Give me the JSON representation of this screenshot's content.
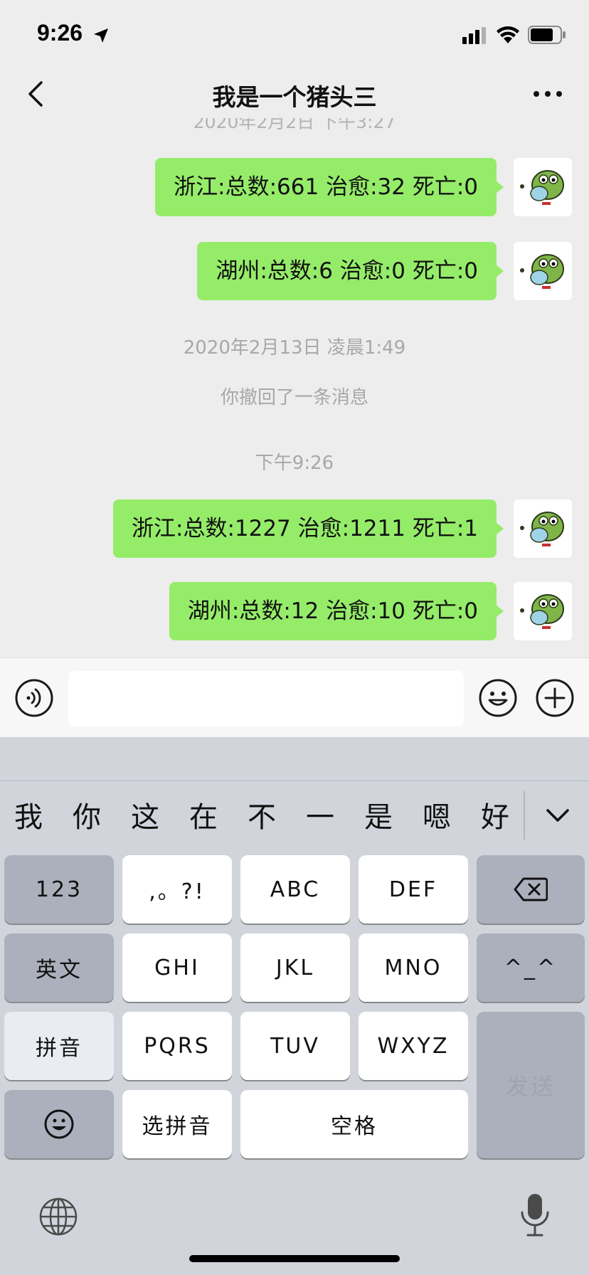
{
  "status_bar": {
    "time": "9:26",
    "icons": [
      "location-arrow-icon",
      "cellular-icon",
      "wifi-icon",
      "battery-icon"
    ]
  },
  "nav": {
    "title": "我是一个猪头三",
    "back_icon": "chevron-left-icon",
    "more_icon": "ellipsis-icon"
  },
  "chat": {
    "cut_timestamp": "2020年2月2日 下午3:27",
    "messages": [
      {
        "text": "浙江:总数:661 治愈:32 死亡:0"
      },
      {
        "text": "湖州:总数:6 治愈:0 死亡:0"
      },
      {
        "text": "浙江:总数:1227 治愈:1211 死亡:1"
      },
      {
        "text": "湖州:总数:12 治愈:10 死亡:0"
      }
    ],
    "timestamp_1": "2020年2月13日 凌晨1:49",
    "recall_notice": "你撤回了一条消息",
    "timestamp_2": "下午9:26"
  },
  "input_bar": {
    "value": "",
    "placeholder": ""
  },
  "keyboard": {
    "candidates": [
      "我",
      "你",
      "这",
      "在",
      "不",
      "一",
      "是",
      "嗯",
      "好"
    ],
    "keys": {
      "num": "123",
      "punct": ",。?!",
      "abc": "ABC",
      "def": "DEF",
      "english": "英文",
      "ghi": "GHI",
      "jkl": "JKL",
      "mno": "MNO",
      "face": "^_^",
      "pinyin": "拼音",
      "pqrs": "PQRS",
      "tuv": "TUV",
      "wxyz": "WXYZ",
      "select_pinyin": "选拼音",
      "space": "空格",
      "send": "发送"
    }
  },
  "colors": {
    "bubble": "#95ec69",
    "background": "#ededed",
    "keyboard": "#d1d4db"
  }
}
